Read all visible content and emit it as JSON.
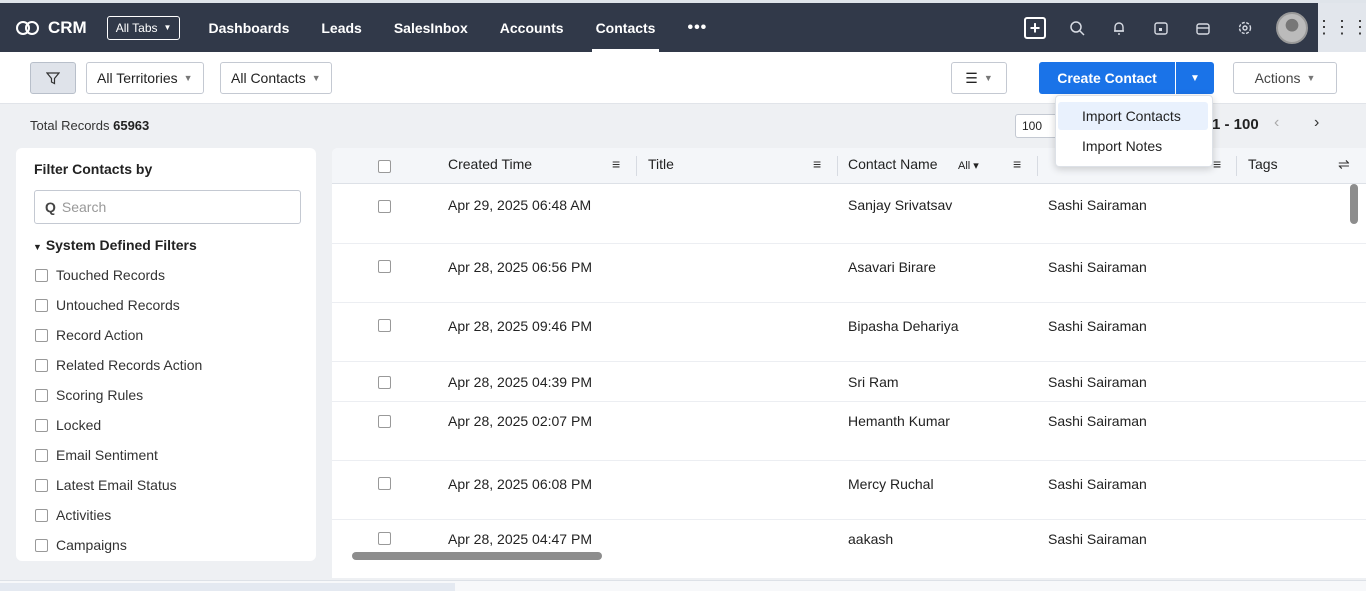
{
  "nav": {
    "brand": "CRM",
    "all_tabs": "All Tabs",
    "tabs": [
      "Dashboards",
      "Leads",
      "SalesInbox",
      "Accounts",
      "Contacts"
    ],
    "active_tab": "Contacts",
    "more": "•••"
  },
  "toolbar": {
    "territories": "All Territories",
    "view": "All Contacts",
    "create_contact": "Create Contact",
    "actions": "Actions"
  },
  "records": {
    "label": "Total Records",
    "count": "65963",
    "per_page": "100",
    "range": "1 - 100"
  },
  "filters": {
    "title": "Filter Contacts by",
    "search_placeholder": "Search",
    "group": "System Defined Filters",
    "items": [
      "Touched Records",
      "Untouched Records",
      "Record Action",
      "Related Records Action",
      "Scoring Rules",
      "Locked",
      "Email Sentiment",
      "Latest Email Status",
      "Activities",
      "Campaigns"
    ]
  },
  "table": {
    "columns": {
      "created": "Created Time",
      "title": "Title",
      "name": "Contact Name",
      "name_filter": "All",
      "tags": "Tags"
    },
    "rows": [
      {
        "created": "Apr 29, 2025 06:48 AM",
        "name": "Sanjay Srivatsav",
        "owner": "Sashi Sairaman"
      },
      {
        "created": "Apr 28, 2025 06:56 PM",
        "name": "Asavari Birare",
        "owner": "Sashi Sairaman"
      },
      {
        "created": "Apr 28, 2025 09:46 PM",
        "name": "Bipasha Dehariya",
        "owner": "Sashi Sairaman"
      },
      {
        "created": "Apr 28, 2025 04:39 PM",
        "name": "Sri Ram",
        "owner": "Sashi Sairaman"
      },
      {
        "created": "Apr 28, 2025 02:07 PM",
        "name": "Hemanth Kumar",
        "owner": "Sashi Sairaman"
      },
      {
        "created": "Apr 28, 2025 06:08 PM",
        "name": "Mercy Ruchal",
        "owner": "Sashi Sairaman"
      },
      {
        "created": "Apr 28, 2025 04:47 PM",
        "name": "aakash",
        "owner": "Sashi Sairaman"
      }
    ]
  },
  "create_menu": {
    "items": [
      "Import Contacts",
      "Import Notes"
    ]
  },
  "colors": {
    "nav_bg": "#313949",
    "primary": "#1a73e8"
  }
}
